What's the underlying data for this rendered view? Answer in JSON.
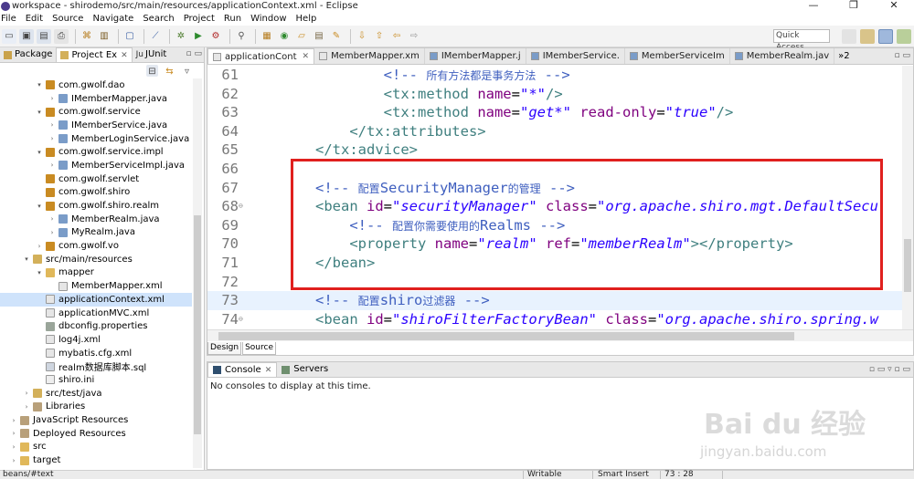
{
  "window": {
    "title": "workspace - shirodemo/src/main/resources/applicationContext.xml - Eclipse",
    "controls": [
      "—",
      "❐",
      "✕"
    ]
  },
  "menu": [
    "File",
    "Edit",
    "Source",
    "Navigate",
    "Search",
    "Project",
    "Run",
    "Window",
    "Help"
  ],
  "toolbar": {
    "quick_access": "Quick Access"
  },
  "left_panel": {
    "tabs": [
      {
        "label": "Package",
        "close": ""
      },
      {
        "label": "Project Ex",
        "close": "✕"
      },
      {
        "label": "JUnit",
        "close": ""
      }
    ],
    "tab_overflow": "▫ ▭",
    "tree": [
      {
        "indent": 3,
        "twisty": "▾",
        "icon": "package-icon",
        "label": "com.gwolf.dao"
      },
      {
        "indent": 4,
        "twisty": "›",
        "icon": "java-file-icon",
        "label": "IMemberMapper.java"
      },
      {
        "indent": 3,
        "twisty": "▾",
        "icon": "package-icon",
        "label": "com.gwolf.service"
      },
      {
        "indent": 4,
        "twisty": "›",
        "icon": "java-file-icon",
        "label": "IMemberService.java"
      },
      {
        "indent": 4,
        "twisty": "›",
        "icon": "java-file-icon",
        "label": "MemberLoginService.java"
      },
      {
        "indent": 3,
        "twisty": "▾",
        "icon": "package-icon",
        "label": "com.gwolf.service.impl"
      },
      {
        "indent": 4,
        "twisty": "›",
        "icon": "java-file-icon",
        "label": "MemberServiceImpl.java"
      },
      {
        "indent": 3,
        "twisty": "",
        "icon": "package-icon",
        "label": "com.gwolf.servlet"
      },
      {
        "indent": 3,
        "twisty": "",
        "icon": "package-icon",
        "label": "com.gwolf.shiro"
      },
      {
        "indent": 3,
        "twisty": "▾",
        "icon": "package-icon",
        "label": "com.gwolf.shiro.realm"
      },
      {
        "indent": 4,
        "twisty": "›",
        "icon": "java-file-icon",
        "label": "MemberRealm.java"
      },
      {
        "indent": 4,
        "twisty": "›",
        "icon": "java-file-icon",
        "label": "MyRealm.java"
      },
      {
        "indent": 3,
        "twisty": "›",
        "icon": "package-icon",
        "label": "com.gwolf.vo"
      },
      {
        "indent": 2,
        "twisty": "▾",
        "icon": "source-folder-icon",
        "label": "src/main/resources"
      },
      {
        "indent": 3,
        "twisty": "▾",
        "icon": "folder-icon",
        "label": "mapper"
      },
      {
        "indent": 4,
        "twisty": "",
        "icon": "xml-file-icon",
        "label": "MemberMapper.xml"
      },
      {
        "indent": 3,
        "twisty": "",
        "icon": "xml-file-icon",
        "label": "applicationContext.xml",
        "selected": true
      },
      {
        "indent": 3,
        "twisty": "",
        "icon": "xml-file-icon",
        "label": "applicationMVC.xml"
      },
      {
        "indent": 3,
        "twisty": "",
        "icon": "properties-file-icon",
        "label": "dbconfig.properties"
      },
      {
        "indent": 3,
        "twisty": "",
        "icon": "xml-file-icon",
        "label": "log4j.xml"
      },
      {
        "indent": 3,
        "twisty": "",
        "icon": "xml-file-icon",
        "label": "mybatis.cfg.xml"
      },
      {
        "indent": 3,
        "twisty": "",
        "icon": "sql-file-icon",
        "label": "realm数据库脚本.sql"
      },
      {
        "indent": 3,
        "twisty": "",
        "icon": "ini-file-icon",
        "label": "shiro.ini"
      },
      {
        "indent": 2,
        "twisty": "›",
        "icon": "source-folder-icon",
        "label": "src/test/java"
      },
      {
        "indent": 2,
        "twisty": "›",
        "icon": "library-icon",
        "label": "Libraries"
      },
      {
        "indent": 1,
        "twisty": "›",
        "icon": "library-icon",
        "label": "JavaScript Resources"
      },
      {
        "indent": 1,
        "twisty": "›",
        "icon": "library-icon",
        "label": "Deployed Resources"
      },
      {
        "indent": 1,
        "twisty": "›",
        "icon": "folder-icon",
        "label": "src"
      },
      {
        "indent": 1,
        "twisty": "›",
        "icon": "folder-icon",
        "label": "target"
      }
    ]
  },
  "editor": {
    "tabs": [
      {
        "label": "applicationCont",
        "close": "✕",
        "active": true,
        "icon": "xml-file-icon"
      },
      {
        "label": "MemberMapper.xm",
        "close": "",
        "active": false,
        "icon": "xml-file-icon"
      },
      {
        "label": "IMemberMapper.j",
        "close": "",
        "active": false,
        "icon": "java-file-icon"
      },
      {
        "label": "IMemberService.",
        "close": "",
        "active": false,
        "icon": "java-file-icon"
      },
      {
        "label": "MemberServiceIm",
        "close": "",
        "active": false,
        "icon": "java-file-icon"
      },
      {
        "label": "MemberRealm.jav",
        "close": "",
        "active": false,
        "icon": "java-file-icon"
      }
    ],
    "overflow": "»2",
    "bottom_tabs": [
      "Design",
      "Source"
    ],
    "lines": [
      {
        "num": "61",
        "fold": "",
        "indent": "        ",
        "parts": [
          [
            "c-cmt",
            "<!-- "
          ],
          [
            "c-cmt c-cn",
            "所有方法都是事务方法"
          ],
          [
            "c-cmt",
            " -->"
          ]
        ]
      },
      {
        "num": "62",
        "fold": "",
        "indent": "        ",
        "parts": [
          [
            "c-tag",
            "<tx:method "
          ],
          [
            "c-attr",
            "name"
          ],
          [
            "",
            "="
          ],
          [
            "c-val",
            "\"*\""
          ],
          [
            "c-tag",
            "/>"
          ]
        ]
      },
      {
        "num": "63",
        "fold": "",
        "indent": "        ",
        "parts": [
          [
            "c-tag",
            "<tx:method "
          ],
          [
            "c-attr",
            "name"
          ],
          [
            "",
            "="
          ],
          [
            "c-val",
            "\"get*\""
          ],
          [
            "",
            " "
          ],
          [
            "c-attr",
            "read-only"
          ],
          [
            "",
            "="
          ],
          [
            "c-val",
            "\"true\""
          ],
          [
            "c-tag",
            "/>"
          ]
        ]
      },
      {
        "num": "64",
        "fold": "",
        "indent": "    ",
        "parts": [
          [
            "c-tag",
            "</tx:attributes>"
          ]
        ]
      },
      {
        "num": "65",
        "fold": "",
        "indent": "",
        "parts": [
          [
            "c-tag",
            "</tx:advice>"
          ]
        ]
      },
      {
        "num": "66",
        "fold": "",
        "indent": "",
        "parts": []
      },
      {
        "num": "67",
        "fold": "",
        "indent": "",
        "parts": [
          [
            "c-cmt",
            "<!-- "
          ],
          [
            "c-cmt c-cn",
            "配置"
          ],
          [
            "c-cmt",
            "SecurityManager"
          ],
          [
            "c-cmt c-cn",
            "的管理"
          ],
          [
            "c-cmt",
            " -->"
          ]
        ]
      },
      {
        "num": "68",
        "fold": "⊖",
        "indent": "",
        "parts": [
          [
            "c-tag",
            "<bean "
          ],
          [
            "c-attr",
            "id"
          ],
          [
            "",
            "="
          ],
          [
            "c-val",
            "\"securityManager\""
          ],
          [
            "",
            " "
          ],
          [
            "c-attr",
            "class"
          ],
          [
            "",
            "="
          ],
          [
            "c-val",
            "\"org.apache.shiro.mgt.DefaultSecu"
          ]
        ]
      },
      {
        "num": "69",
        "fold": "",
        "indent": "    ",
        "parts": [
          [
            "c-cmt",
            "<!-- "
          ],
          [
            "c-cmt c-cn",
            "配置你需要使用的"
          ],
          [
            "c-cmt",
            "Realms -->"
          ]
        ]
      },
      {
        "num": "70",
        "fold": "",
        "indent": "    ",
        "parts": [
          [
            "c-tag",
            "<property "
          ],
          [
            "c-attr",
            "name"
          ],
          [
            "",
            "="
          ],
          [
            "c-val",
            "\"realm\""
          ],
          [
            "",
            " "
          ],
          [
            "c-attr",
            "ref"
          ],
          [
            "",
            "="
          ],
          [
            "c-val",
            "\"memberRealm\""
          ],
          [
            "c-tag",
            "></property>"
          ]
        ]
      },
      {
        "num": "71",
        "fold": "",
        "indent": "",
        "parts": [
          [
            "c-tag",
            "</bean>"
          ]
        ]
      },
      {
        "num": "72",
        "fold": "",
        "indent": "",
        "parts": []
      },
      {
        "num": "73",
        "fold": "",
        "indent": "",
        "current": true,
        "parts": [
          [
            "c-cmt",
            "<!-- "
          ],
          [
            "c-cmt c-cn",
            "配置"
          ],
          [
            "c-cmt",
            "shiro"
          ],
          [
            "c-cmt c-cn",
            "过滤器"
          ],
          [
            "c-cmt",
            " -->"
          ]
        ]
      },
      {
        "num": "74",
        "fold": "⊖",
        "indent": "",
        "parts": [
          [
            "c-tag",
            "<bean "
          ],
          [
            "c-attr",
            "id"
          ],
          [
            "",
            "="
          ],
          [
            "c-val",
            "\"shiroFilterFactoryBean\""
          ],
          [
            "",
            " "
          ],
          [
            "c-attr",
            "class"
          ],
          [
            "",
            "="
          ],
          [
            "c-val",
            "\"org.apache.shiro.spring.w"
          ]
        ]
      }
    ]
  },
  "console": {
    "tabs": [
      {
        "label": "Console",
        "close": "✕",
        "active": true
      },
      {
        "label": "Servers",
        "close": "",
        "active": false
      }
    ],
    "message": "No consoles to display at this time."
  },
  "status": {
    "path": "beans/#text",
    "writable": "Writable",
    "insert_mode": "Smart Insert",
    "position": "73 : 28"
  },
  "watermark": {
    "brand": "Bai du 经验",
    "url": "jingyan.baidu.com"
  },
  "colors": {
    "highlight_box": "#e0201e",
    "comment": "#3f5fbf",
    "tag": "#3f7f7f",
    "attribute": "#7f007f",
    "value": "#2a00ff"
  }
}
